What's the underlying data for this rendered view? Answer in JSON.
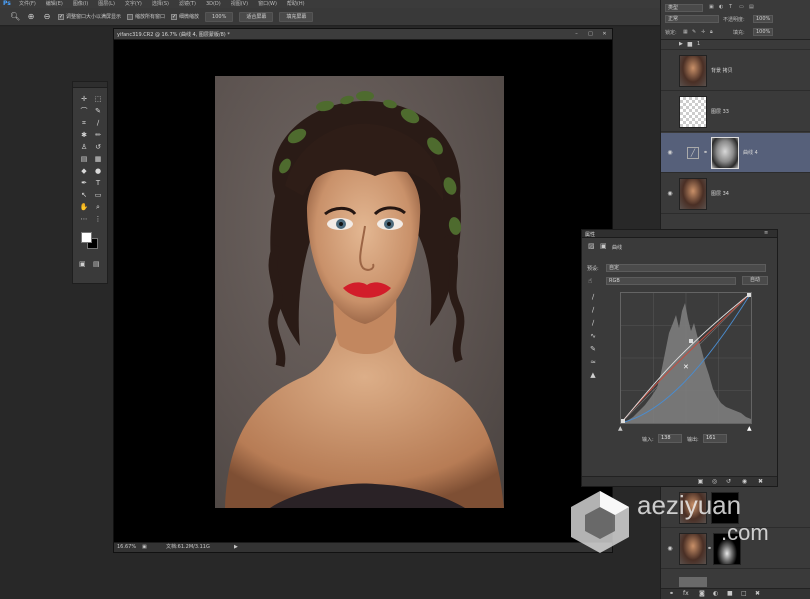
{
  "app": {
    "logo": "Ps",
    "menus": [
      "文件(F)",
      "编辑(E)",
      "图像(I)",
      "图层(L)",
      "文字(Y)",
      "选择(S)",
      "滤镜(T)",
      "3D(D)",
      "视图(V)",
      "窗口(W)",
      "帮助(H)"
    ]
  },
  "options_bar": {
    "chk_resize": "调整窗口大小以满屏显示",
    "chk_all_windows": "缩放所有窗口",
    "chk_scrubby": "细微缩放",
    "btn_100": "100%",
    "btn_fit": "适合屏幕",
    "btn_fill": "填充屏幕"
  },
  "document": {
    "tab_title": "yifanc319.CR2 @ 16.7% (曲线 4, 图层蒙版/8) *",
    "zoom": "16.67%",
    "doc_info": "文档:61.2M/3.11G"
  },
  "layers_panel": {
    "kind": "类型",
    "blend_mode": "正常",
    "opacity_label": "不透明度:",
    "opacity": "100%",
    "lock_label": "锁定:",
    "fill_label": "填充:",
    "fill": "100%",
    "group_name": "1",
    "layers": [
      {
        "name": "背景 拷贝",
        "thumb": "portrait"
      },
      {
        "name": "图层 33",
        "thumb": "transparent"
      },
      {
        "name": "曲线 4",
        "thumb": "mask"
      },
      {
        "name": "图层 34",
        "thumb": "portrait"
      },
      {
        "name": "",
        "thumb": "portrait"
      },
      {
        "name": "",
        "thumb": "portrait"
      }
    ]
  },
  "properties_panel": {
    "tab": "属性",
    "adj_name": "曲线",
    "preset_label": "预设:",
    "preset": "自定",
    "channel": "RGB",
    "auto_btn": "自动",
    "input_label": "输入:",
    "input": "138",
    "output_label": "输出:",
    "output": "161"
  },
  "watermark": {
    "text": "aeziyuan",
    "sub": ".com"
  }
}
